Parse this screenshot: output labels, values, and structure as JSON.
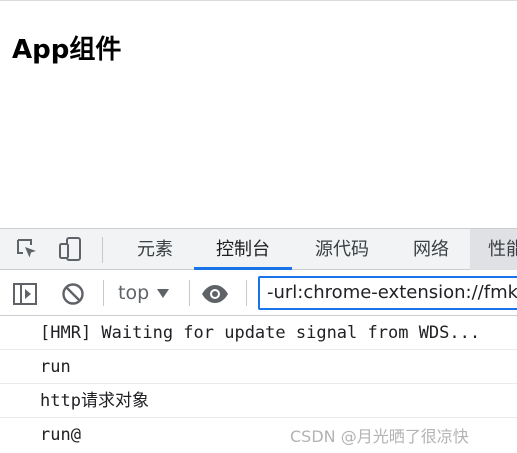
{
  "page": {
    "title": "App组件"
  },
  "devtools": {
    "tabs": [
      {
        "label": "元素",
        "active": false
      },
      {
        "label": "控制台",
        "active": true
      },
      {
        "label": "源代码",
        "active": false
      },
      {
        "label": "网络",
        "active": false
      },
      {
        "label": "性能",
        "active": false
      }
    ],
    "toolbar_icons": [
      "inspect-element-icon",
      "device-toolbar-icon"
    ],
    "console_toolbar": {
      "context": "top",
      "filter_value": "-url:chrome-extension://fmkadmapgofadopljbjfkapdkoienihi"
    },
    "logs": [
      {
        "text": "[HMR] Waiting for update signal from WDS..."
      },
      {
        "text": "run"
      },
      {
        "prefix": "http",
        "suffix": "请求对象"
      },
      {
        "text": "run@"
      }
    ]
  },
  "watermark": "CSDN @月光晒了很凉快",
  "colors": {
    "accent": "#1a73e8",
    "tabbar_bg": "#f1f3f4",
    "text": "#202124"
  }
}
